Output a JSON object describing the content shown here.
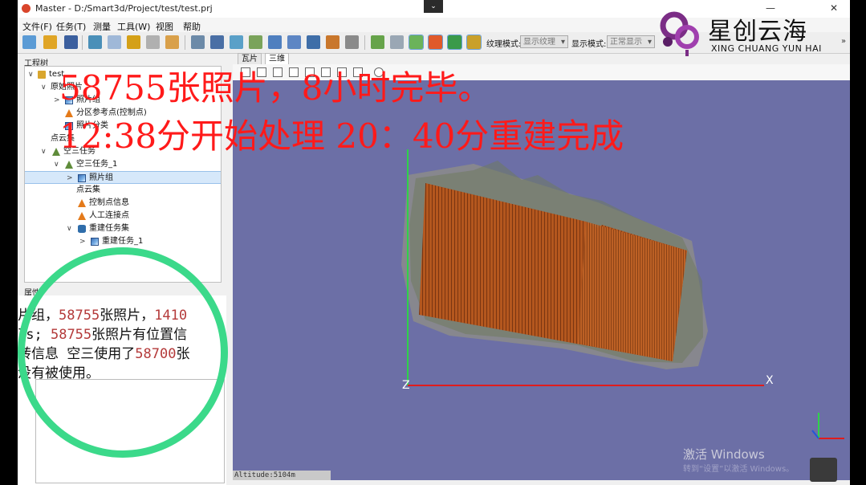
{
  "window": {
    "title": "Master - D:/Smart3d/Project/test/test.prj",
    "collapse_glyph": "⌄",
    "minimize_glyph": "—",
    "close_glyph": "✕"
  },
  "logo": {
    "cn": "星创云海",
    "en": "XING CHUANG YUN HAI"
  },
  "menu": [
    "文件(F)",
    "任务(T)",
    "测量",
    "工具(W)",
    "视图",
    "帮助"
  ],
  "toolbar": {
    "texture_mode_label": "纹理模式:",
    "texture_mode_value": "显示纹理",
    "display_mode_label": "显示模式:",
    "display_mode_value": "正常显示",
    "more": "»"
  },
  "tree": {
    "header": "工程树",
    "rows": [
      {
        "label": "test",
        "tw": "∨",
        "icon": "folder"
      },
      {
        "label": "原始照片",
        "tw": "∨",
        "icon": ""
      },
      {
        "label": "照片组",
        "tw": ">",
        "icon": "photos"
      },
      {
        "label": "分区参考点(控制点)",
        "tw": "",
        "icon": "warn"
      },
      {
        "label": "照片分类",
        "tw": "",
        "icon": "photos"
      },
      {
        "label": "点云集",
        "tw": "",
        "icon": ""
      },
      {
        "label": "空三任务",
        "tw": "∨",
        "icon": "flask"
      },
      {
        "label": "空三任务_1",
        "tw": "∨",
        "icon": "flask"
      },
      {
        "label": "照片组",
        "tw": ">",
        "icon": "photos"
      },
      {
        "label": "点云集",
        "tw": "",
        "icon": ""
      },
      {
        "label": "控制点信息",
        "tw": "",
        "icon": "warn"
      },
      {
        "label": "人工连接点",
        "tw": "",
        "icon": "warn"
      },
      {
        "label": "重建任务集",
        "tw": "∨",
        "icon": "db"
      },
      {
        "label": "重建任务_1",
        "tw": ">",
        "icon": "photos"
      }
    ]
  },
  "info": {
    "header": "属性",
    "line1_pre": "片组，",
    "line1_num": "58755",
    "line1_mid": "张照片，",
    "line1_num2": "1410",
    "line2_pre": "ls;",
    "line2_num": "58755",
    "line2_post": "张照片有位置信",
    "line3_pre": "转信息 空三使用了",
    "line3_num": "58700",
    "line3_post": "张",
    "line4": "没有被使用。"
  },
  "tabs": [
    "瓦片",
    "三维"
  ],
  "overlay": {
    "line1": "58755张照片，8小时完毕。",
    "line2": "12:38分开始处理 20：40分重建完成"
  },
  "viewport": {
    "axis_z": "Z",
    "axis_x": "X",
    "altitude": "Altitude:5104m"
  },
  "watermark": {
    "line1": "激活 Windows",
    "line2": "转到“设置”以激活 Windows。"
  },
  "colors": {
    "viewport_bg": "#6c6fa6",
    "overlay_text": "#ff1a1a",
    "ring": "#3bd98a",
    "model": "#b4571e"
  }
}
